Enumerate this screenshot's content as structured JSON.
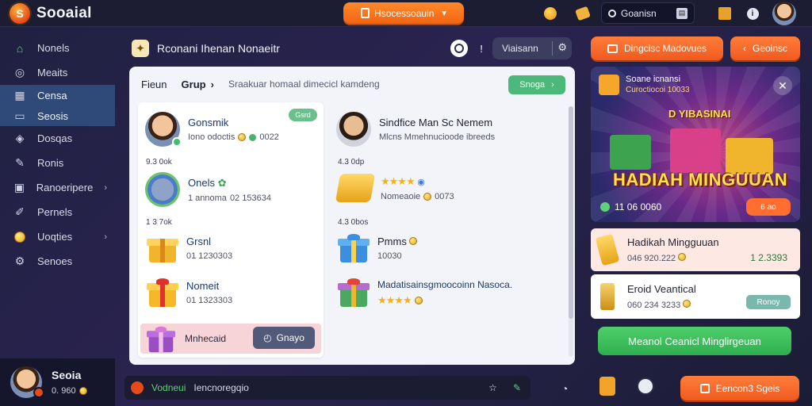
{
  "app": {
    "title": "Sooaial",
    "promo_label": "Hsocessoauin",
    "search_label": "Goanisn"
  },
  "sidebar": {
    "items": [
      {
        "label": "Nonels",
        "icon": "home-icon"
      },
      {
        "label": "Meaits",
        "icon": "compass-icon"
      },
      {
        "label": "Censa",
        "icon": "grid-icon"
      },
      {
        "label": "Seosis",
        "icon": "card-icon"
      },
      {
        "label": "Dosqas",
        "icon": "shield-icon"
      },
      {
        "label": "Ronis",
        "icon": "pencil-icon"
      },
      {
        "label": "Ranoeripere",
        "icon": "folder-icon"
      },
      {
        "label": "Pernels",
        "icon": "brush-icon"
      },
      {
        "label": "Uoqties",
        "icon": "coin-icon"
      },
      {
        "label": "Senoes",
        "icon": "gear-icon"
      }
    ],
    "user": {
      "name": "Seoia",
      "balance": "0. 960"
    }
  },
  "center_header": {
    "title": "Rconani Ihenan Nonaeitr",
    "pill_label": "Viaisann"
  },
  "panel": {
    "tab1": "Fieun",
    "tab2": "Grup",
    "hint": "Sraakuar homaal dimecicl kamdeng",
    "add_label": "Snoga",
    "left": {
      "rows": [
        {
          "name": "Gonsmik",
          "detail": "Iono odoctis",
          "value": "0022",
          "chip": "Gsrd"
        },
        {
          "name": "Onels",
          "detail": "1 annoma",
          "value": "02 153634"
        },
        {
          "name": "Grsnl",
          "detail": "01 1230303"
        },
        {
          "name": "Nomeit",
          "detail": "01 1323303"
        }
      ],
      "sep1": "9.3 0ok",
      "sep2": "1 3 7ok",
      "highlight": {
        "name": "Mnhecaid",
        "button": "Gnayo"
      }
    },
    "right": {
      "rows": [
        {
          "name": "Sindfice Man Sc Nemem",
          "detail": "Mlcns Mmehnucioode ibreeds"
        },
        {
          "name": "Nomeaoie",
          "detail": "0073"
        },
        {
          "name": "Pmms",
          "detail": "10030"
        },
        {
          "name": "Madatisainsgmoocoinn Nasoca."
        }
      ],
      "sep1": "4.3 0dp",
      "sep2": "4.3 0bos",
      "stars": "★★★★"
    }
  },
  "right_col": {
    "btn1": "Dingcisc Madovues",
    "btn2": "Geoinsc",
    "banner": {
      "line1": "Soane icnansi",
      "line2": "Curoctiocoi 10033",
      "tag": "D YIBASINAI",
      "big": "HADIAH MINGUUAN",
      "foot": "11 06 0060",
      "badge": "6 ao"
    },
    "card1": {
      "name": "Hadikah Mingguuan",
      "detail": "046 920.222",
      "amount": "1 2.3393"
    },
    "card2": {
      "name": "Eroid Veantical",
      "detail": "060 234 3233",
      "chip": "Ronoy"
    },
    "claim": "Meanol Ceanicl Minglirgeuan"
  },
  "bottombar": {
    "online": "Vodneui",
    "text": "Iencnoregqio",
    "play": "Eencon3 Sgeis"
  },
  "colors": {
    "accent": "#f26412",
    "panel": "#f3f4f9",
    "green": "#2fae4f",
    "active_nav": "#2f4a78"
  }
}
